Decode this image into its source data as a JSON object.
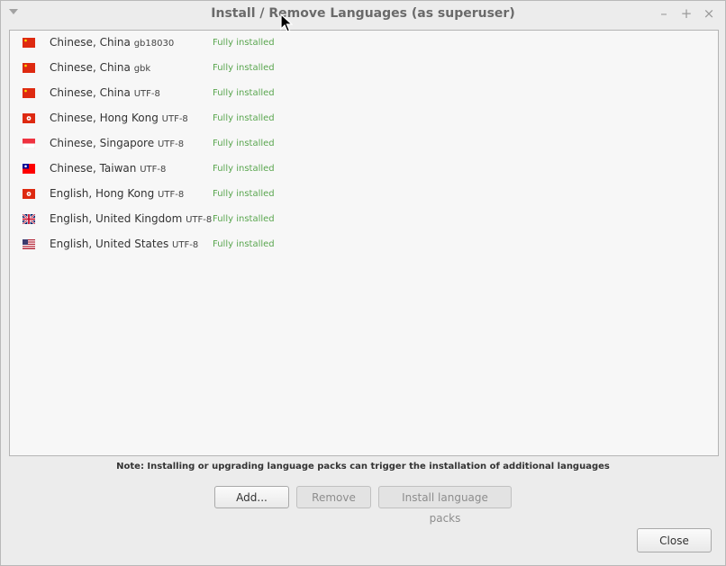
{
  "window": {
    "title": "Install / Remove Languages (as superuser)",
    "controls": {
      "minimize": "–",
      "maximize": "+",
      "close": "×"
    }
  },
  "languages": [
    {
      "name": "Chinese, China",
      "encoding": "gb18030",
      "status": "Fully installed",
      "flag": "china-flag-icon"
    },
    {
      "name": "Chinese, China",
      "encoding": "gbk",
      "status": "Fully installed",
      "flag": "china-flag-icon"
    },
    {
      "name": "Chinese, China",
      "encoding": "UTF-8",
      "status": "Fully installed",
      "flag": "china-flag-icon"
    },
    {
      "name": "Chinese, Hong Kong",
      "encoding": "UTF-8",
      "status": "Fully installed",
      "flag": "hong-kong-flag-icon"
    },
    {
      "name": "Chinese, Singapore",
      "encoding": "UTF-8",
      "status": "Fully installed",
      "flag": "singapore-flag-icon"
    },
    {
      "name": "Chinese, Taiwan",
      "encoding": "UTF-8",
      "status": "Fully installed",
      "flag": "taiwan-flag-icon"
    },
    {
      "name": "English, Hong Kong",
      "encoding": "UTF-8",
      "status": "Fully installed",
      "flag": "hong-kong-flag-icon"
    },
    {
      "name": "English, United Kingdom",
      "encoding": "UTF-8",
      "status": "Fully installed",
      "flag": "uk-flag-icon"
    },
    {
      "name": "English, United States",
      "encoding": "UTF-8",
      "status": "Fully installed",
      "flag": "us-flag-icon"
    }
  ],
  "note": "Note: Installing or upgrading language packs can trigger the installation of additional languages",
  "buttons": {
    "add": "Add...",
    "remove": "Remove",
    "install": "Install language packs",
    "close": "Close"
  },
  "colors": {
    "status_green": "#5aa64f",
    "flag_red": "#de2910"
  }
}
